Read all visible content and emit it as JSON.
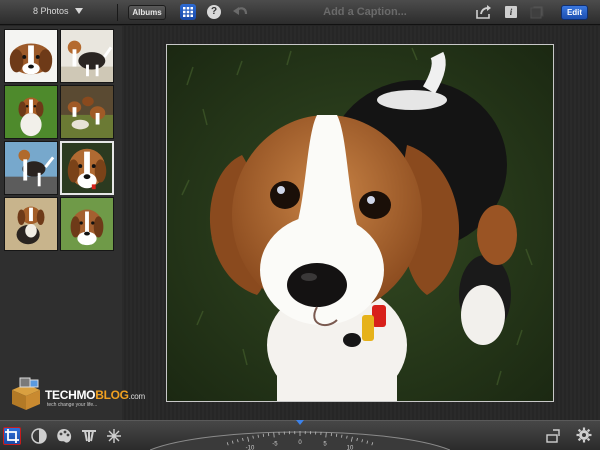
{
  "topbar": {
    "photos_count": "8 Photos",
    "albums_label": "Albums",
    "help_label": "?",
    "caption_placeholder": "Add a Caption...",
    "info_label": "i",
    "edit_label": "Edit"
  },
  "thumbnails": [
    {
      "name": "thumb-1",
      "selected": false
    },
    {
      "name": "thumb-2",
      "selected": false
    },
    {
      "name": "thumb-3",
      "selected": false
    },
    {
      "name": "thumb-4",
      "selected": false
    },
    {
      "name": "thumb-5",
      "selected": false
    },
    {
      "name": "thumb-6",
      "selected": true
    },
    {
      "name": "thumb-7",
      "selected": false
    },
    {
      "name": "thumb-8",
      "selected": false
    }
  ],
  "watermark": {
    "techmo": "TECHMO",
    "blog": "BLOG",
    "dotcom": ".com",
    "tagline": "tech change your life..."
  },
  "bottombar": {
    "tools": [
      "crop-icon",
      "exposure-icon",
      "palette-icon",
      "brush-icon",
      "effects-icon"
    ],
    "dial_labels": [
      "-10",
      "-5",
      "0",
      "5",
      "10"
    ],
    "right_tools": [
      "straighten-icon",
      "gear-icon"
    ]
  },
  "colors": {
    "accent_blue": "#2d6ad1",
    "active_border": "#c91a1a",
    "watermark_orange": "#f0a020"
  }
}
